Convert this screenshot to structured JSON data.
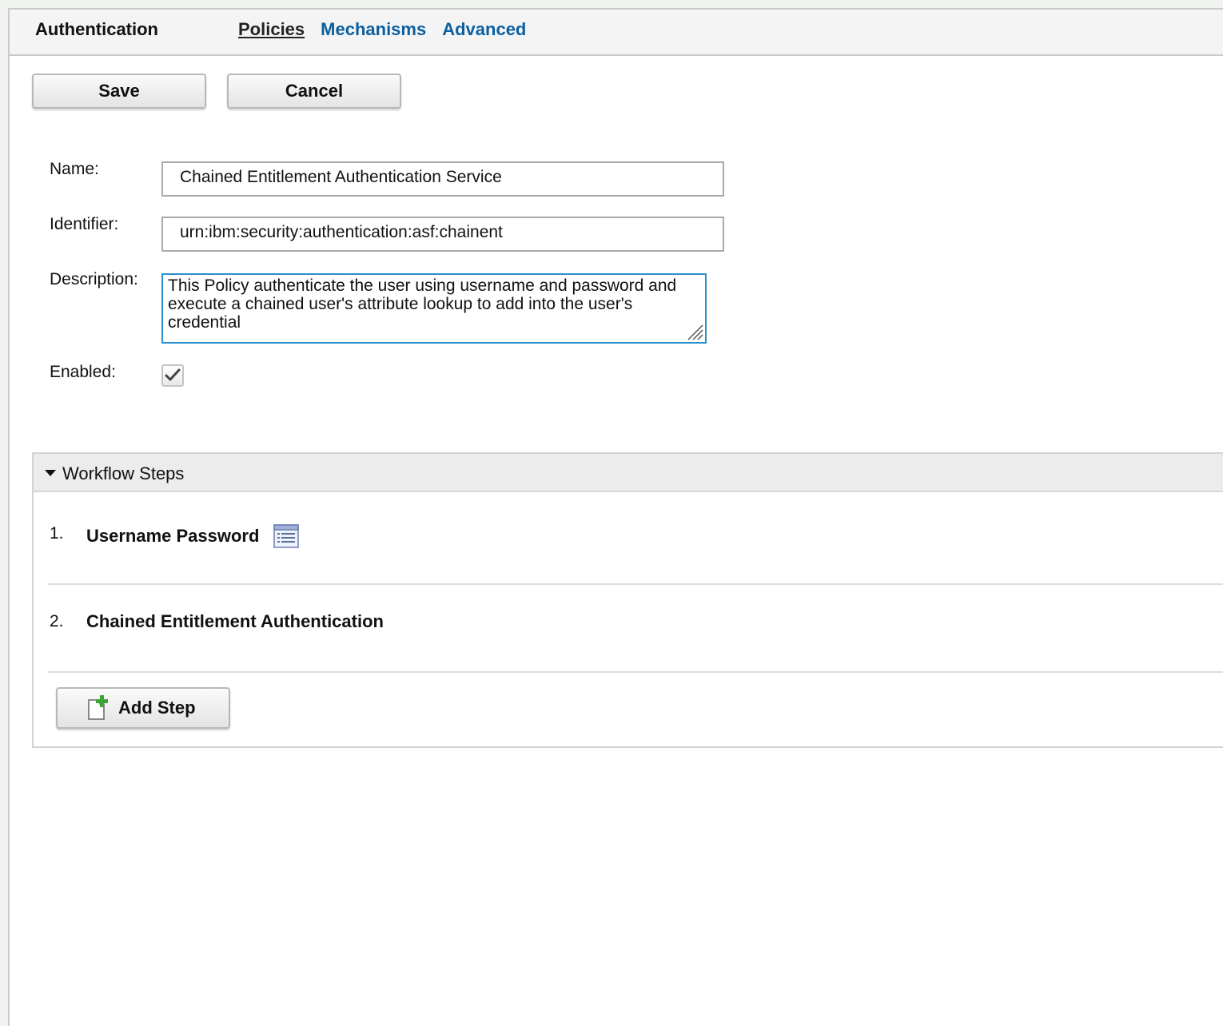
{
  "header": {
    "title": "Authentication",
    "tabs": [
      {
        "label": "Policies",
        "active": true
      },
      {
        "label": "Mechanisms",
        "active": false
      },
      {
        "label": "Advanced",
        "active": false
      }
    ]
  },
  "toolbar": {
    "save_label": "Save",
    "cancel_label": "Cancel"
  },
  "form": {
    "name_label": "Name:",
    "name_value": "Chained Entitlement Authentication Service",
    "identifier_label": "Identifier:",
    "identifier_value": "urn:ibm:security:authentication:asf:chainent",
    "description_label": "Description:",
    "description_value": "This Policy authenticate the user using username and password and execute a chained user's attribute lookup to add into the user's credential",
    "enabled_label": "Enabled:",
    "enabled_checked": true
  },
  "workflow": {
    "title": "Workflow Steps",
    "expanded": true,
    "steps": [
      {
        "number": "1.",
        "name": "Username Password",
        "icon": "properties-list-icon"
      },
      {
        "number": "2.",
        "name": "Chained Entitlement Authentication"
      }
    ],
    "add_step_label": "Add Step",
    "add_step_icon": "add-document-icon"
  },
  "colors": {
    "link": "#0b5f9e",
    "focus_border": "#2a8fd0",
    "add_icon_green": "#3fa33a"
  }
}
